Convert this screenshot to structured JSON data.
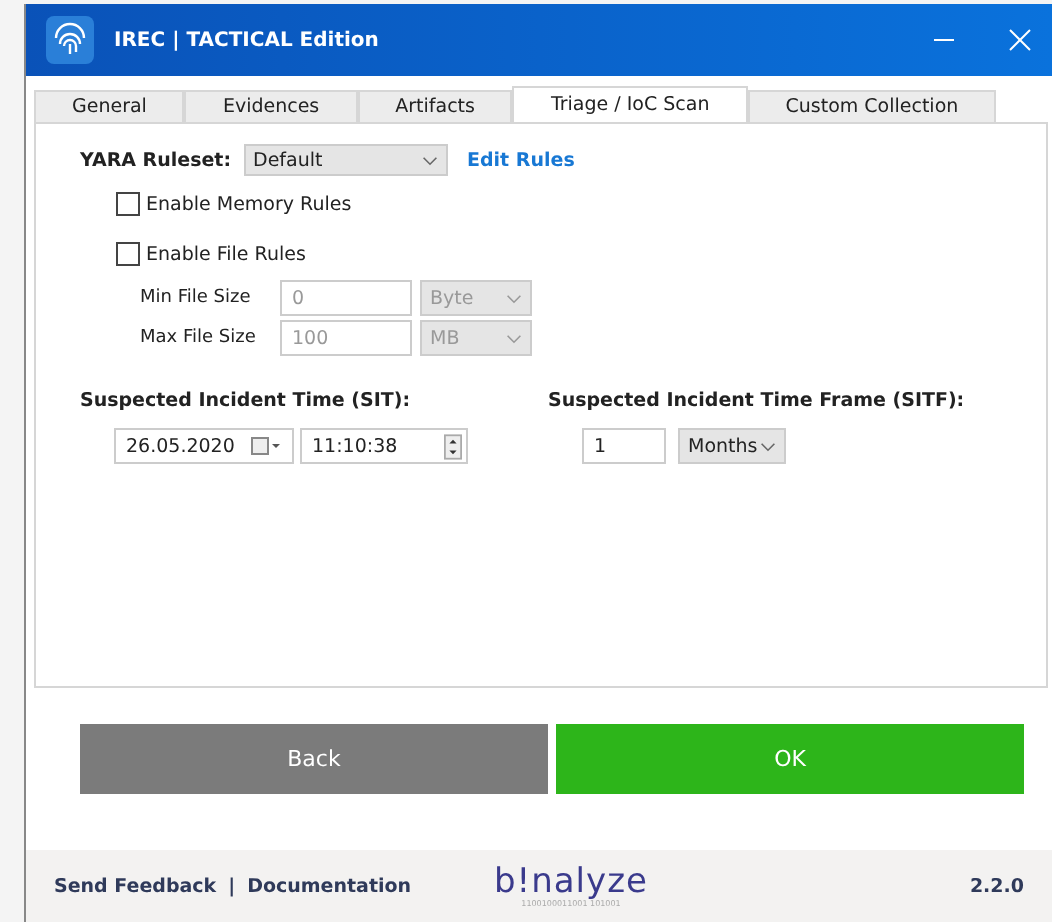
{
  "window": {
    "title": "IREC  | TACTICAL Edition"
  },
  "tabs": [
    {
      "label": "General",
      "selected": false
    },
    {
      "label": "Evidences",
      "selected": false
    },
    {
      "label": "Artifacts",
      "selected": false
    },
    {
      "label": "Triage / IoC Scan",
      "selected": true
    },
    {
      "label": "Custom Collection",
      "selected": false
    }
  ],
  "yara": {
    "label": "YARA Ruleset:",
    "value": "Default",
    "link": "Edit Rules"
  },
  "options": [
    {
      "label": "Enable Memory Rules",
      "checked": false
    },
    {
      "label": "Enable File Rules",
      "checked": false
    }
  ],
  "file_sizes": [
    {
      "label": "Min File Size",
      "value": "0",
      "unit": "Byte",
      "disabled": true
    },
    {
      "label": "Max File Size",
      "value": "100",
      "unit": "MB",
      "disabled": true
    }
  ],
  "sit": {
    "label": "Suspected Incident Time (SIT):",
    "date": "26.05.2020",
    "time": "11:10:38"
  },
  "sitf": {
    "label": "Suspected Incident Time Frame (SITF):",
    "value": "1",
    "unit": "Months"
  },
  "buttons": [
    {
      "label": "Back",
      "kind": "secondary"
    },
    {
      "label": "OK",
      "kind": "primary"
    }
  ],
  "footer": {
    "links": [
      "Send Feedback",
      "Documentation"
    ],
    "separator": "|",
    "logo": "b!nalyze",
    "tagline": "1100100011001   101001",
    "version": "2.2.0"
  }
}
